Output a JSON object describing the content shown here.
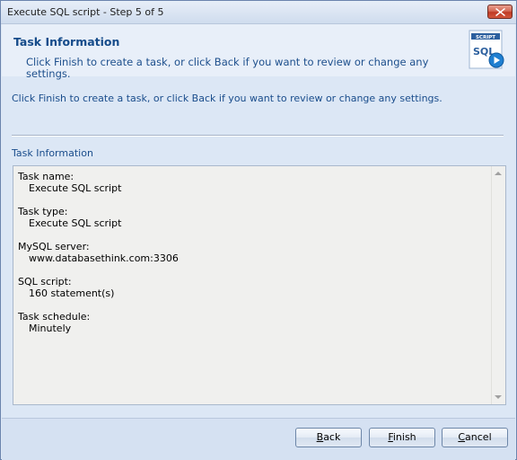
{
  "window": {
    "title": "Execute SQL script - Step 5 of 5"
  },
  "header": {
    "title": "Task Information",
    "description": "Click Finish to create a task, or click Back if you want to review or change any settings.",
    "logo_caption": "SCRIPT",
    "logo_text": "SQL"
  },
  "body": {
    "intro": "Click Finish to create a task, or click Back if you want to review or change any settings.",
    "section_label": "Task Information",
    "info": [
      {
        "label": "Task name:",
        "value": "Execute SQL script"
      },
      {
        "label": "Task type:",
        "value": "Execute SQL script"
      },
      {
        "label": "MySQL server:",
        "value": "www.databasethink.com:3306"
      },
      {
        "label": "SQL script:",
        "value": "160 statement(s)"
      },
      {
        "label": "Task schedule:",
        "value": "Minutely"
      }
    ]
  },
  "buttons": {
    "back": {
      "mnemonic": "B",
      "rest": "ack"
    },
    "finish": {
      "mnemonic": "F",
      "rest": "inish"
    },
    "cancel": {
      "mnemonic": "C",
      "rest": "ancel"
    }
  },
  "icons": {
    "close": "close-icon",
    "logo": "sql-script-icon",
    "play": "play-icon",
    "scroll_up": "scroll-up-icon",
    "scroll_down": "scroll-down-icon"
  },
  "colors": {
    "header_text": "#154b8a",
    "body_text": "#1a4d8c",
    "close_button": "#c9432c"
  }
}
